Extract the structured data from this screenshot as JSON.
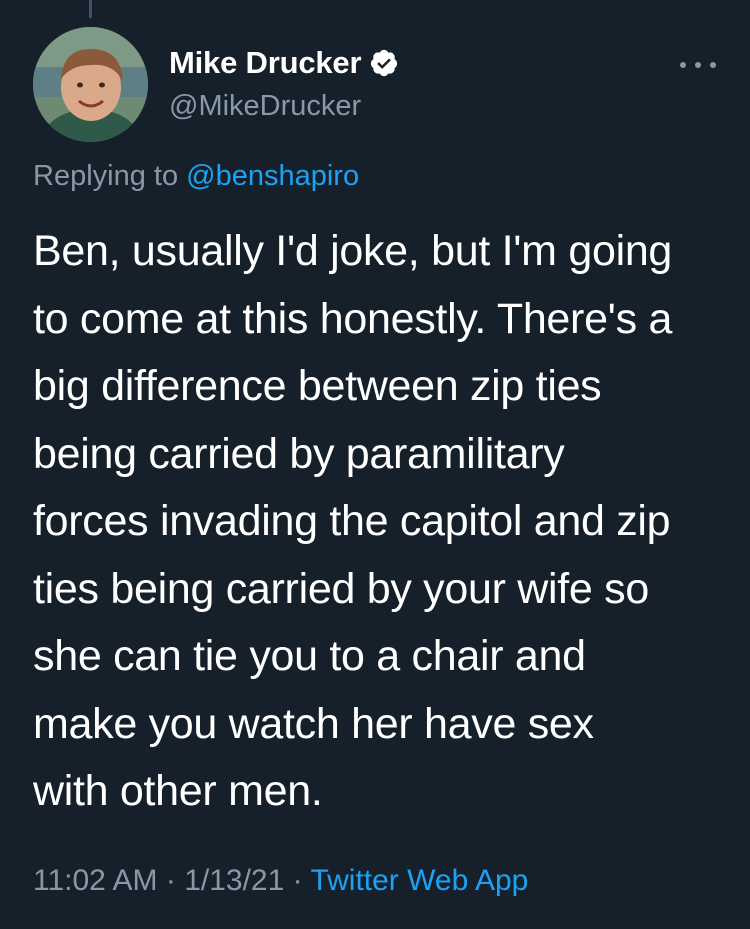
{
  "author": {
    "display_name": "Mike Drucker",
    "handle": "@MikeDrucker",
    "verified": true
  },
  "reply": {
    "prefix": "Replying to",
    "mention": "@benshapiro"
  },
  "tweet": {
    "lines": [
      "Ben, usually I'd joke, but I'm going",
      "to come at this honestly. There's a",
      "big difference between zip ties",
      "being carried by paramilitary",
      "forces invading the capitol and zip",
      "ties being carried by your wife so",
      "she can tie you to a chair and",
      "make you watch her have sex",
      "with other men."
    ]
  },
  "meta": {
    "time": "11:02 AM",
    "separator": "·",
    "date": "1/13/21",
    "source": "Twitter Web App"
  },
  "icons": {
    "verified": "verified-badge-icon",
    "more": "more-options-icon",
    "avatar": "profile-avatar"
  },
  "colors": {
    "background": "#15202b",
    "text": "#ffffff",
    "secondary": "#8899a6",
    "accent": "#1da1f2"
  }
}
